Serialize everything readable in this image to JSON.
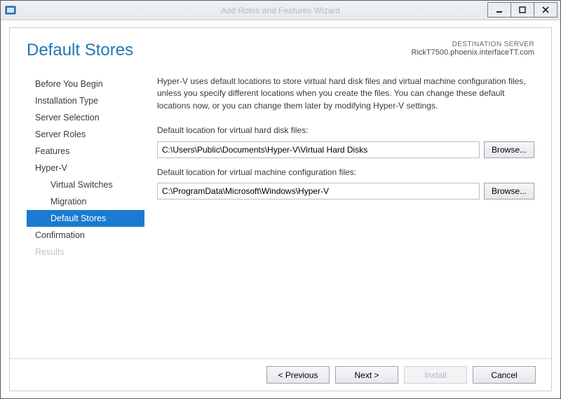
{
  "window": {
    "title": "Add Roles and Features Wizard"
  },
  "header": {
    "page_title": "Default Stores",
    "destination_label": "DESTINATION SERVER",
    "destination_server": "RickT7500.phoenix.interfaceTT.com"
  },
  "nav": {
    "items": [
      {
        "label": "Before You Begin",
        "sub": false,
        "state": "normal"
      },
      {
        "label": "Installation Type",
        "sub": false,
        "state": "normal"
      },
      {
        "label": "Server Selection",
        "sub": false,
        "state": "normal"
      },
      {
        "label": "Server Roles",
        "sub": false,
        "state": "normal"
      },
      {
        "label": "Features",
        "sub": false,
        "state": "normal"
      },
      {
        "label": "Hyper-V",
        "sub": false,
        "state": "normal"
      },
      {
        "label": "Virtual Switches",
        "sub": true,
        "state": "normal"
      },
      {
        "label": "Migration",
        "sub": true,
        "state": "normal"
      },
      {
        "label": "Default Stores",
        "sub": true,
        "state": "selected"
      },
      {
        "label": "Confirmation",
        "sub": false,
        "state": "normal"
      },
      {
        "label": "Results",
        "sub": false,
        "state": "disabled"
      }
    ]
  },
  "main": {
    "intro": "Hyper-V uses default locations to store virtual hard disk files and virtual machine configuration files, unless you specify different locations when you create the files. You can change these default locations now, or you can change them later by modifying Hyper-V settings.",
    "vhd_label": "Default location for virtual hard disk files:",
    "vhd_value": "C:\\Users\\Public\\Documents\\Hyper-V\\Virtual Hard Disks",
    "vmcfg_label": "Default location for virtual machine configuration files:",
    "vmcfg_value": "C:\\ProgramData\\Microsoft\\Windows\\Hyper-V",
    "browse_label": "Browse..."
  },
  "footer": {
    "previous": "< Previous",
    "next": "Next >",
    "install": "Install",
    "cancel": "Cancel"
  }
}
